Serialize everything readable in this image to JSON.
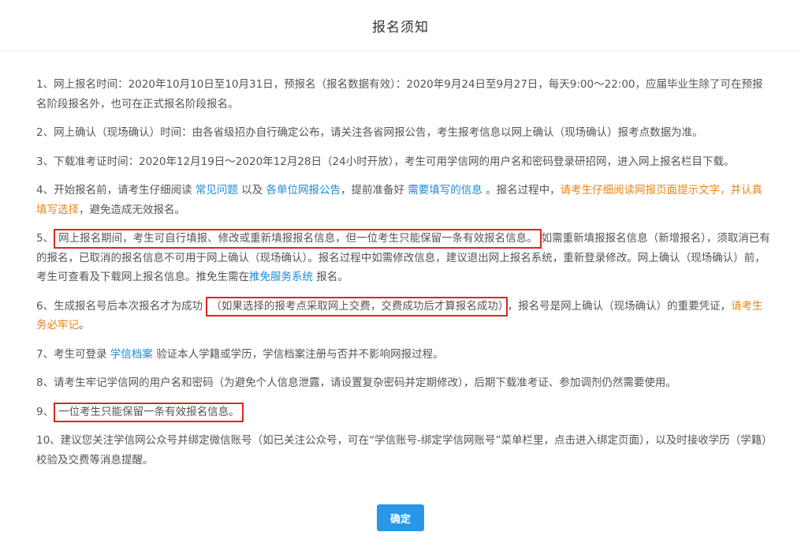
{
  "dialog": {
    "title": "报名须知",
    "confirm_label": "确定"
  },
  "items": {
    "i1": "1、网上报名时间：2020年10月10日至10月31日，预报名（报名数据有效）：2020年9月24日至9月27日，每天9:00～22:00，应届毕业生除了可在预报名阶段报名外，也可在正式报名阶段报名。",
    "i2": "2、网上确认（现场确认）时间：由各省级招办自行确定公布，请关注各省网报公告，考生报考信息以网上确认（现场确认）报考点数据为准。",
    "i3": "3、下载准考证时间：2020年12月19日～2020年12月28日（24小时开放），考生可用学信网的用户名和密码登录研招网，进入网上报名栏目下载。",
    "i4": {
      "a": "4、开始报名前，请考生仔细阅读 ",
      "link1": "常见问题",
      "b": " 以及 ",
      "link2": "各单位网报公告",
      "c": "，提前准备好 ",
      "link3": "需要填写的信息",
      "d": " 。报名过程中，",
      "warn": "请考生仔细阅读网报页面提示文字，并认真填写选择",
      "e": "，避免造成无效报名。"
    },
    "i5": {
      "prefix": "5、",
      "boxed": "网上报名期间，考生可自行填报、修改或重新填报报名信息，但一位考生只能保留一条有效报名信息。",
      "rest": "如需重新填报报名信息（新增报名），须取消已有的报名，已取消的报名信息不可用于网上确认（现场确认）。报名过程中如需修改信息，建议退出网上报名系统，重新登录修改。网上确认（现场确认）前，考生可查看及下载网上报名信息。推免生需在",
      "link": "推免服务系统",
      "end": " 报名。"
    },
    "i6": {
      "a": "6、生成报名号后本次报名才为成功 ",
      "boxed": "（如果选择的报考点采取网上交费，交费成功后才算报名成功）",
      "b": "，报名号是网上确认（现场确认）的重要凭证，",
      "warn": "请考生务必牢记",
      "c": "。"
    },
    "i7": {
      "a": "7、考生可登录 ",
      "link": "学信档案",
      "b": " 验证本人学籍或学历，学信档案注册与否并不影响网报过程。"
    },
    "i8": "8、请考生牢记学信网的用户名和密码（为避免个人信息泄露，请设置复杂密码并定期修改），后期下载准考证、参加调剂仍然需要使用。",
    "i9": {
      "prefix": "9、",
      "boxed": "一位考生只能保留一条有效报名信息。"
    },
    "i10": "10、建议您关注学信网公众号并绑定微信账号（如已关注公众号，可在“学信账号-绑定学信网账号”菜单栏里，点击进入绑定页面），以及时接收学历（学籍）校验及交费等消息提醒。"
  },
  "colors": {
    "link": "#1e8bd6",
    "warning": "#e8861a",
    "highlight_box": "#e02424",
    "button": "#2b96e3"
  }
}
